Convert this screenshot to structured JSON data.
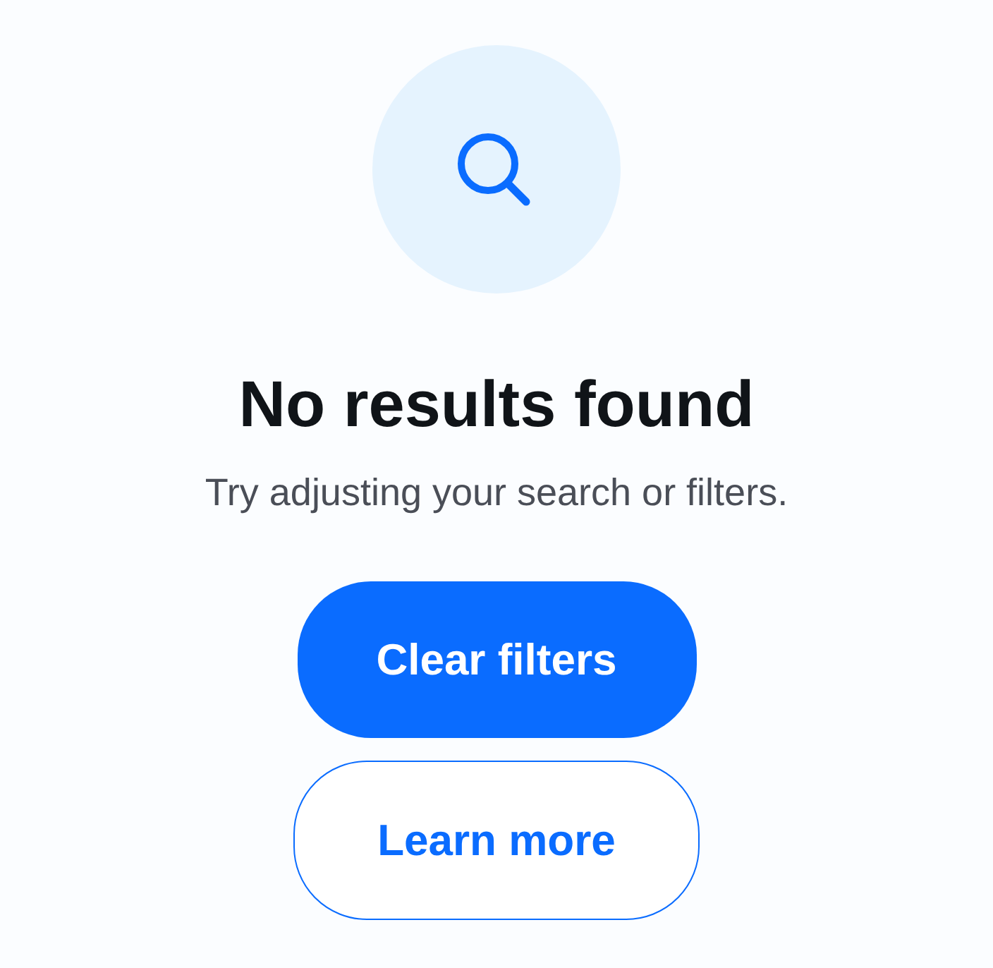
{
  "empty_state": {
    "title": "No results found",
    "message": "Try adjusting your search or filters."
  },
  "buttons": [
    {
      "label": "Clear filters",
      "kind": "primary"
    },
    {
      "label": "Learn more",
      "kind": "secondary"
    }
  ]
}
